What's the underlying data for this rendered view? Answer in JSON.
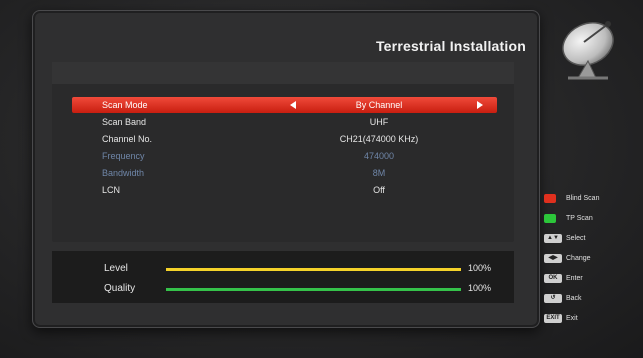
{
  "header": {
    "title": "Terrestrial Installation",
    "icon": "satellite-dish-icon"
  },
  "settings": [
    {
      "label": "Scan Mode",
      "value": "By Channel",
      "state": "selected"
    },
    {
      "label": "Scan Band",
      "value": "UHF",
      "state": "normal"
    },
    {
      "label": "Channel No.",
      "value": "CH21(474000 KHz)",
      "state": "normal"
    },
    {
      "label": "Frequency",
      "value": "474000",
      "state": "disabled"
    },
    {
      "label": "Bandwidth",
      "value": "8M",
      "state": "disabled"
    },
    {
      "label": "LCN",
      "value": "Off",
      "state": "normal"
    }
  ],
  "signal": {
    "level": {
      "label": "Level",
      "percent_text": "100%",
      "fill_percent": 100,
      "color": "#f4d22a"
    },
    "quality": {
      "label": "Quality",
      "percent_text": "100%",
      "fill_percent": 100,
      "color": "#35c24a"
    }
  },
  "legend": [
    {
      "key_type": "color",
      "color": "#e0301e",
      "label": "Blind Scan",
      "icon": "red-key-icon"
    },
    {
      "key_type": "color",
      "color": "#2cc63a",
      "label": "TP Scan",
      "icon": "green-key-icon"
    },
    {
      "key_type": "keycap",
      "key_text": "▲▼",
      "label": "Select",
      "icon": "up-down-key-icon"
    },
    {
      "key_type": "keycap",
      "key_text": "◀▶",
      "label": "Change",
      "icon": "left-right-key-icon"
    },
    {
      "key_type": "keycap",
      "key_text": "OK",
      "label": "Enter",
      "icon": "ok-key-icon"
    },
    {
      "key_type": "keycap",
      "key_text": "↺",
      "label": "Back",
      "icon": "back-key-icon"
    },
    {
      "key_type": "keycap",
      "key_text": "EXIT",
      "label": "Exit",
      "icon": "exit-key-icon"
    }
  ],
  "colors": {
    "selected_row": "#d9281a",
    "disabled_text": "#6f86a8"
  }
}
